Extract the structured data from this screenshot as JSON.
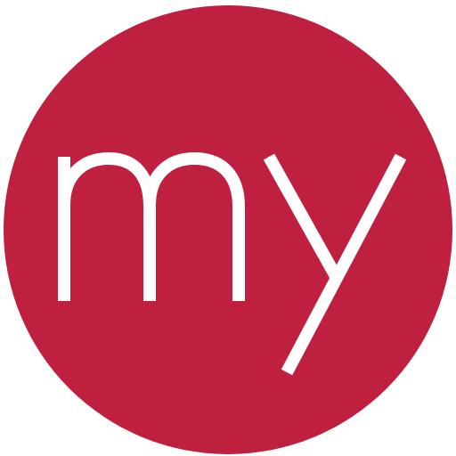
{
  "logo": {
    "text": "my",
    "colors": {
      "circle": "#c0203f",
      "text": "#ffffff",
      "background": "#ffffff"
    }
  }
}
